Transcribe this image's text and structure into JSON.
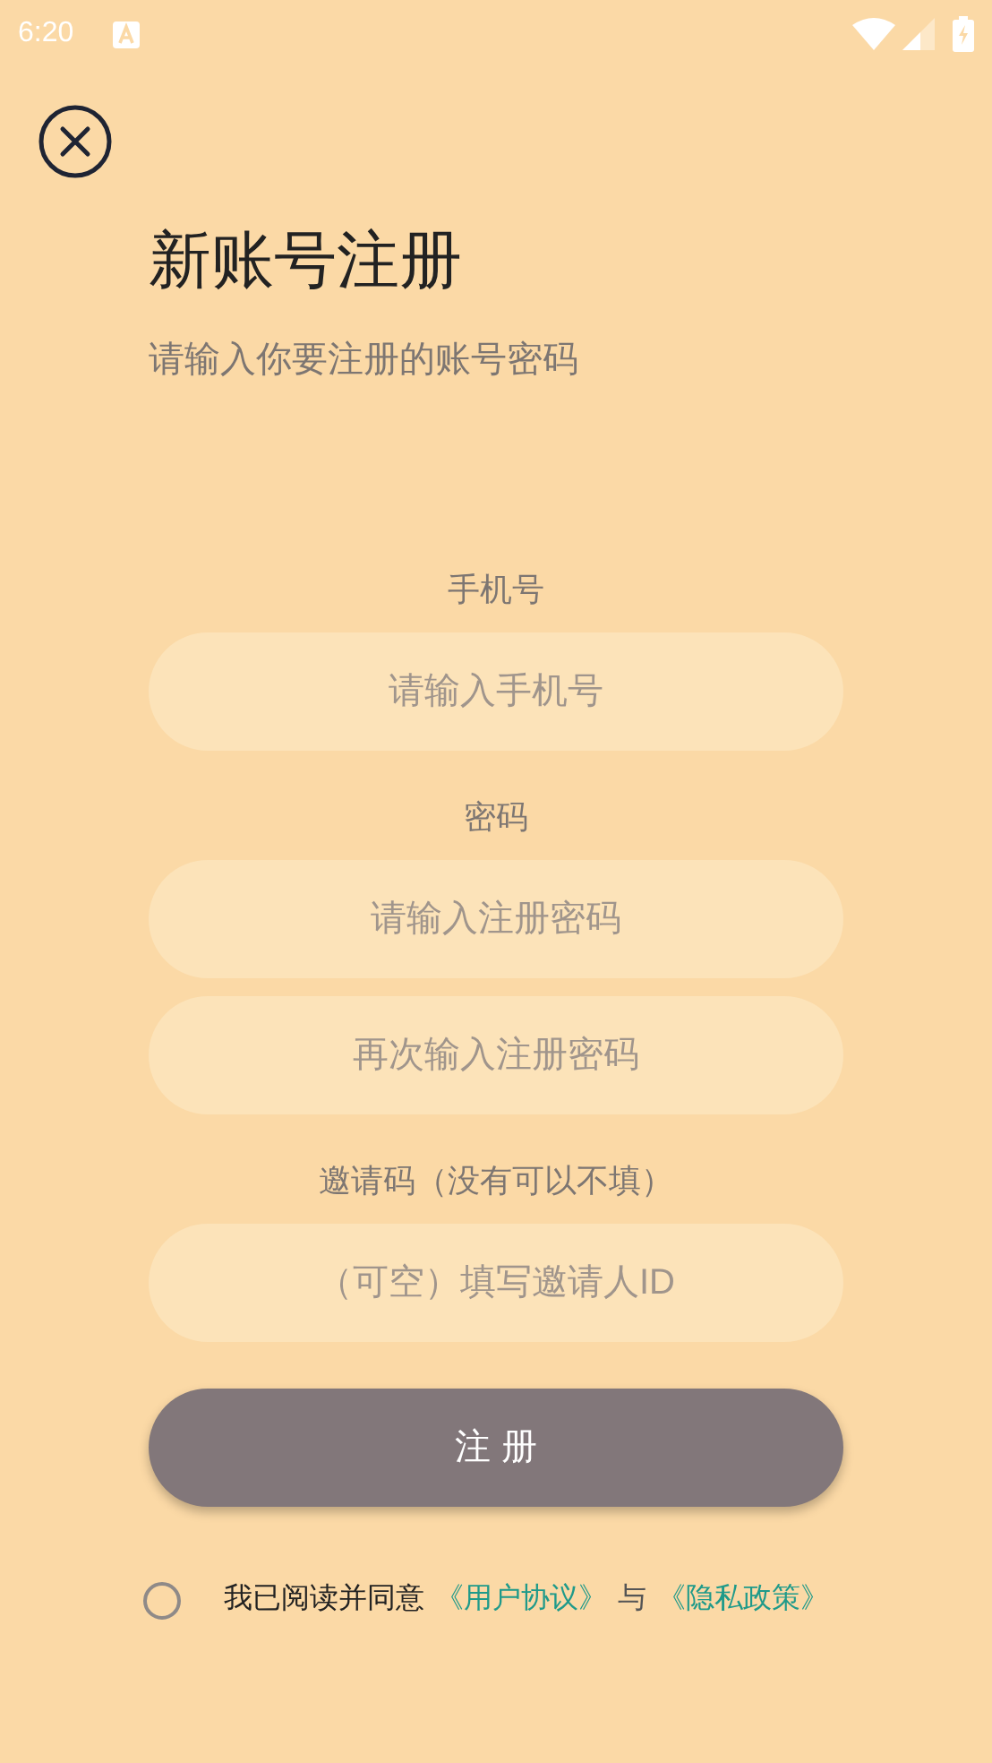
{
  "status_bar": {
    "time": "6:20"
  },
  "title": "新账号注册",
  "subtitle": "请输入你要注册的账号密码",
  "groups": [
    {
      "label": "手机号",
      "inputs": [
        {
          "placeholder": "请输入手机号"
        }
      ]
    },
    {
      "label": "密码",
      "inputs": [
        {
          "placeholder": "请输入注册密码"
        },
        {
          "placeholder": "再次输入注册密码"
        }
      ]
    },
    {
      "label": "邀请码（没有可以不填）",
      "inputs": [
        {
          "placeholder": "（可空）填写邀请人ID"
        }
      ]
    }
  ],
  "submit": "注 册",
  "agreement": {
    "checked": false,
    "text": "我已阅读并同意",
    "link_1": "《用户协议》",
    "joiner": "与",
    "link_2": "《隐私政策》"
  }
}
